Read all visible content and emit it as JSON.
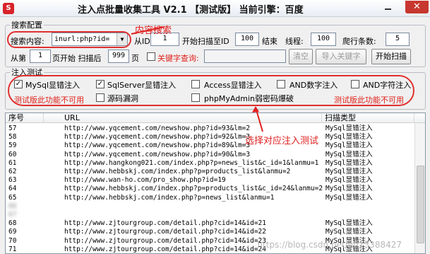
{
  "window": {
    "title": "注入点批量收集工具 V2.1 【测试版】 当前引擎：百度",
    "app_icon": "app-logo-icon",
    "close_glyph": "✕"
  },
  "search_config": {
    "legend": "搜索配置",
    "content_label": "搜索内容:",
    "content_value": "inurl:php?id=",
    "from_id_label": "从ID",
    "from_id_value": "1",
    "to_id_label": "开始扫描至ID",
    "to_id_value": "100",
    "end_label": "结束",
    "threads_label": "线程:",
    "threads_value": "100",
    "rows_label": "爬行条数:",
    "rows_value": "5",
    "from_label": "从第",
    "from_value": "1",
    "start_page_label": "页开始 扫描后",
    "after_value": "999",
    "page_label": "页",
    "keyword_label": "关键字查询:",
    "keyword_value": "",
    "clear_button": "清空",
    "import_button": "导入关键字",
    "start_button": "开始扫描"
  },
  "inject_test": {
    "legend": "注入测试",
    "options": [
      {
        "label": "MySql显错注入",
        "checked": true
      },
      {
        "label": "SqlServer显错注入",
        "checked": true
      },
      {
        "label": "Access显错注入",
        "checked": false
      },
      {
        "label": "AND数字注入",
        "checked": false
      },
      {
        "label": "AND字符注入",
        "checked": false
      },
      {
        "label": "源码漏洞",
        "checked": false
      },
      {
        "label": "phpMyAdmin弱密码爆破",
        "checked": false
      }
    ],
    "disabled_note_left": "测试版此功能不可用",
    "disabled_note_right": "测试版此功能不可用"
  },
  "results": {
    "columns": [
      "序号",
      "URL",
      "扫描类型"
    ],
    "rows": [
      {
        "id": "57",
        "url": "http://www.yqcement.com/newshow.php?id=93&lm=2",
        "type": "MySql显错注入"
      },
      {
        "id": "58",
        "url": "http://www.yqcement.com/newshow.php?id=92&lm=3",
        "type": "MySql显错注入"
      },
      {
        "id": "59",
        "url": "http://www.yqcement.com/newshow.php?id=89&lm=3",
        "type": "MySql显错注入"
      },
      {
        "id": "60",
        "url": "http://www.yqcement.com/newshow.php?id=90&lm=3",
        "type": "MySql显错注入"
      },
      {
        "id": "61",
        "url": "http://www.hangkong021.com/index.php?p=news_list&c_id=1&lanmu=1",
        "type": "MySql显错注入"
      },
      {
        "id": "62",
        "url": "http://www.hebbskj.com/index.php?p=products_list&lanmu=2",
        "type": "MySql显错注入"
      },
      {
        "id": "63",
        "url": "http://www.wan-ho.com/pro_show.php?id=19",
        "type": "MySql显错注入"
      },
      {
        "id": "64",
        "url": "http://www.hebbskj.com/index.php?p=products_list&c_id=24&lanmu=2",
        "type": "MySql显错注入"
      },
      {
        "id": "65",
        "url": "http://www.hebbskj.com/index.php?p=news_list&lanmu=1",
        "type": "MySql显错注入"
      },
      {
        "id": "66",
        "url": "",
        "type": ""
      },
      {
        "id": "67",
        "url": "",
        "type": ""
      },
      {
        "id": "68",
        "url": "http://www.zjtourgroup.com/detail.php?cid=14&id=21",
        "type": "MySql显错注入"
      },
      {
        "id": "69",
        "url": "http://www.zjtourgroup.com/detail.php?cid=14&id=22",
        "type": "MySql显错注入"
      },
      {
        "id": "70",
        "url": "http://www.zjtourgroup.com/detail.php?cid=14&id=23",
        "type": "MySql显错注入"
      },
      {
        "id": "71",
        "url": "http://www.zjtourgroup.com/detail.php?cid=14&id=24",
        "type": "MySql显错注入"
      }
    ]
  },
  "annotations": {
    "search_content_note": "内容搜索",
    "select_test_note": "选择对应注入测试",
    "color": "#e02020"
  }
}
